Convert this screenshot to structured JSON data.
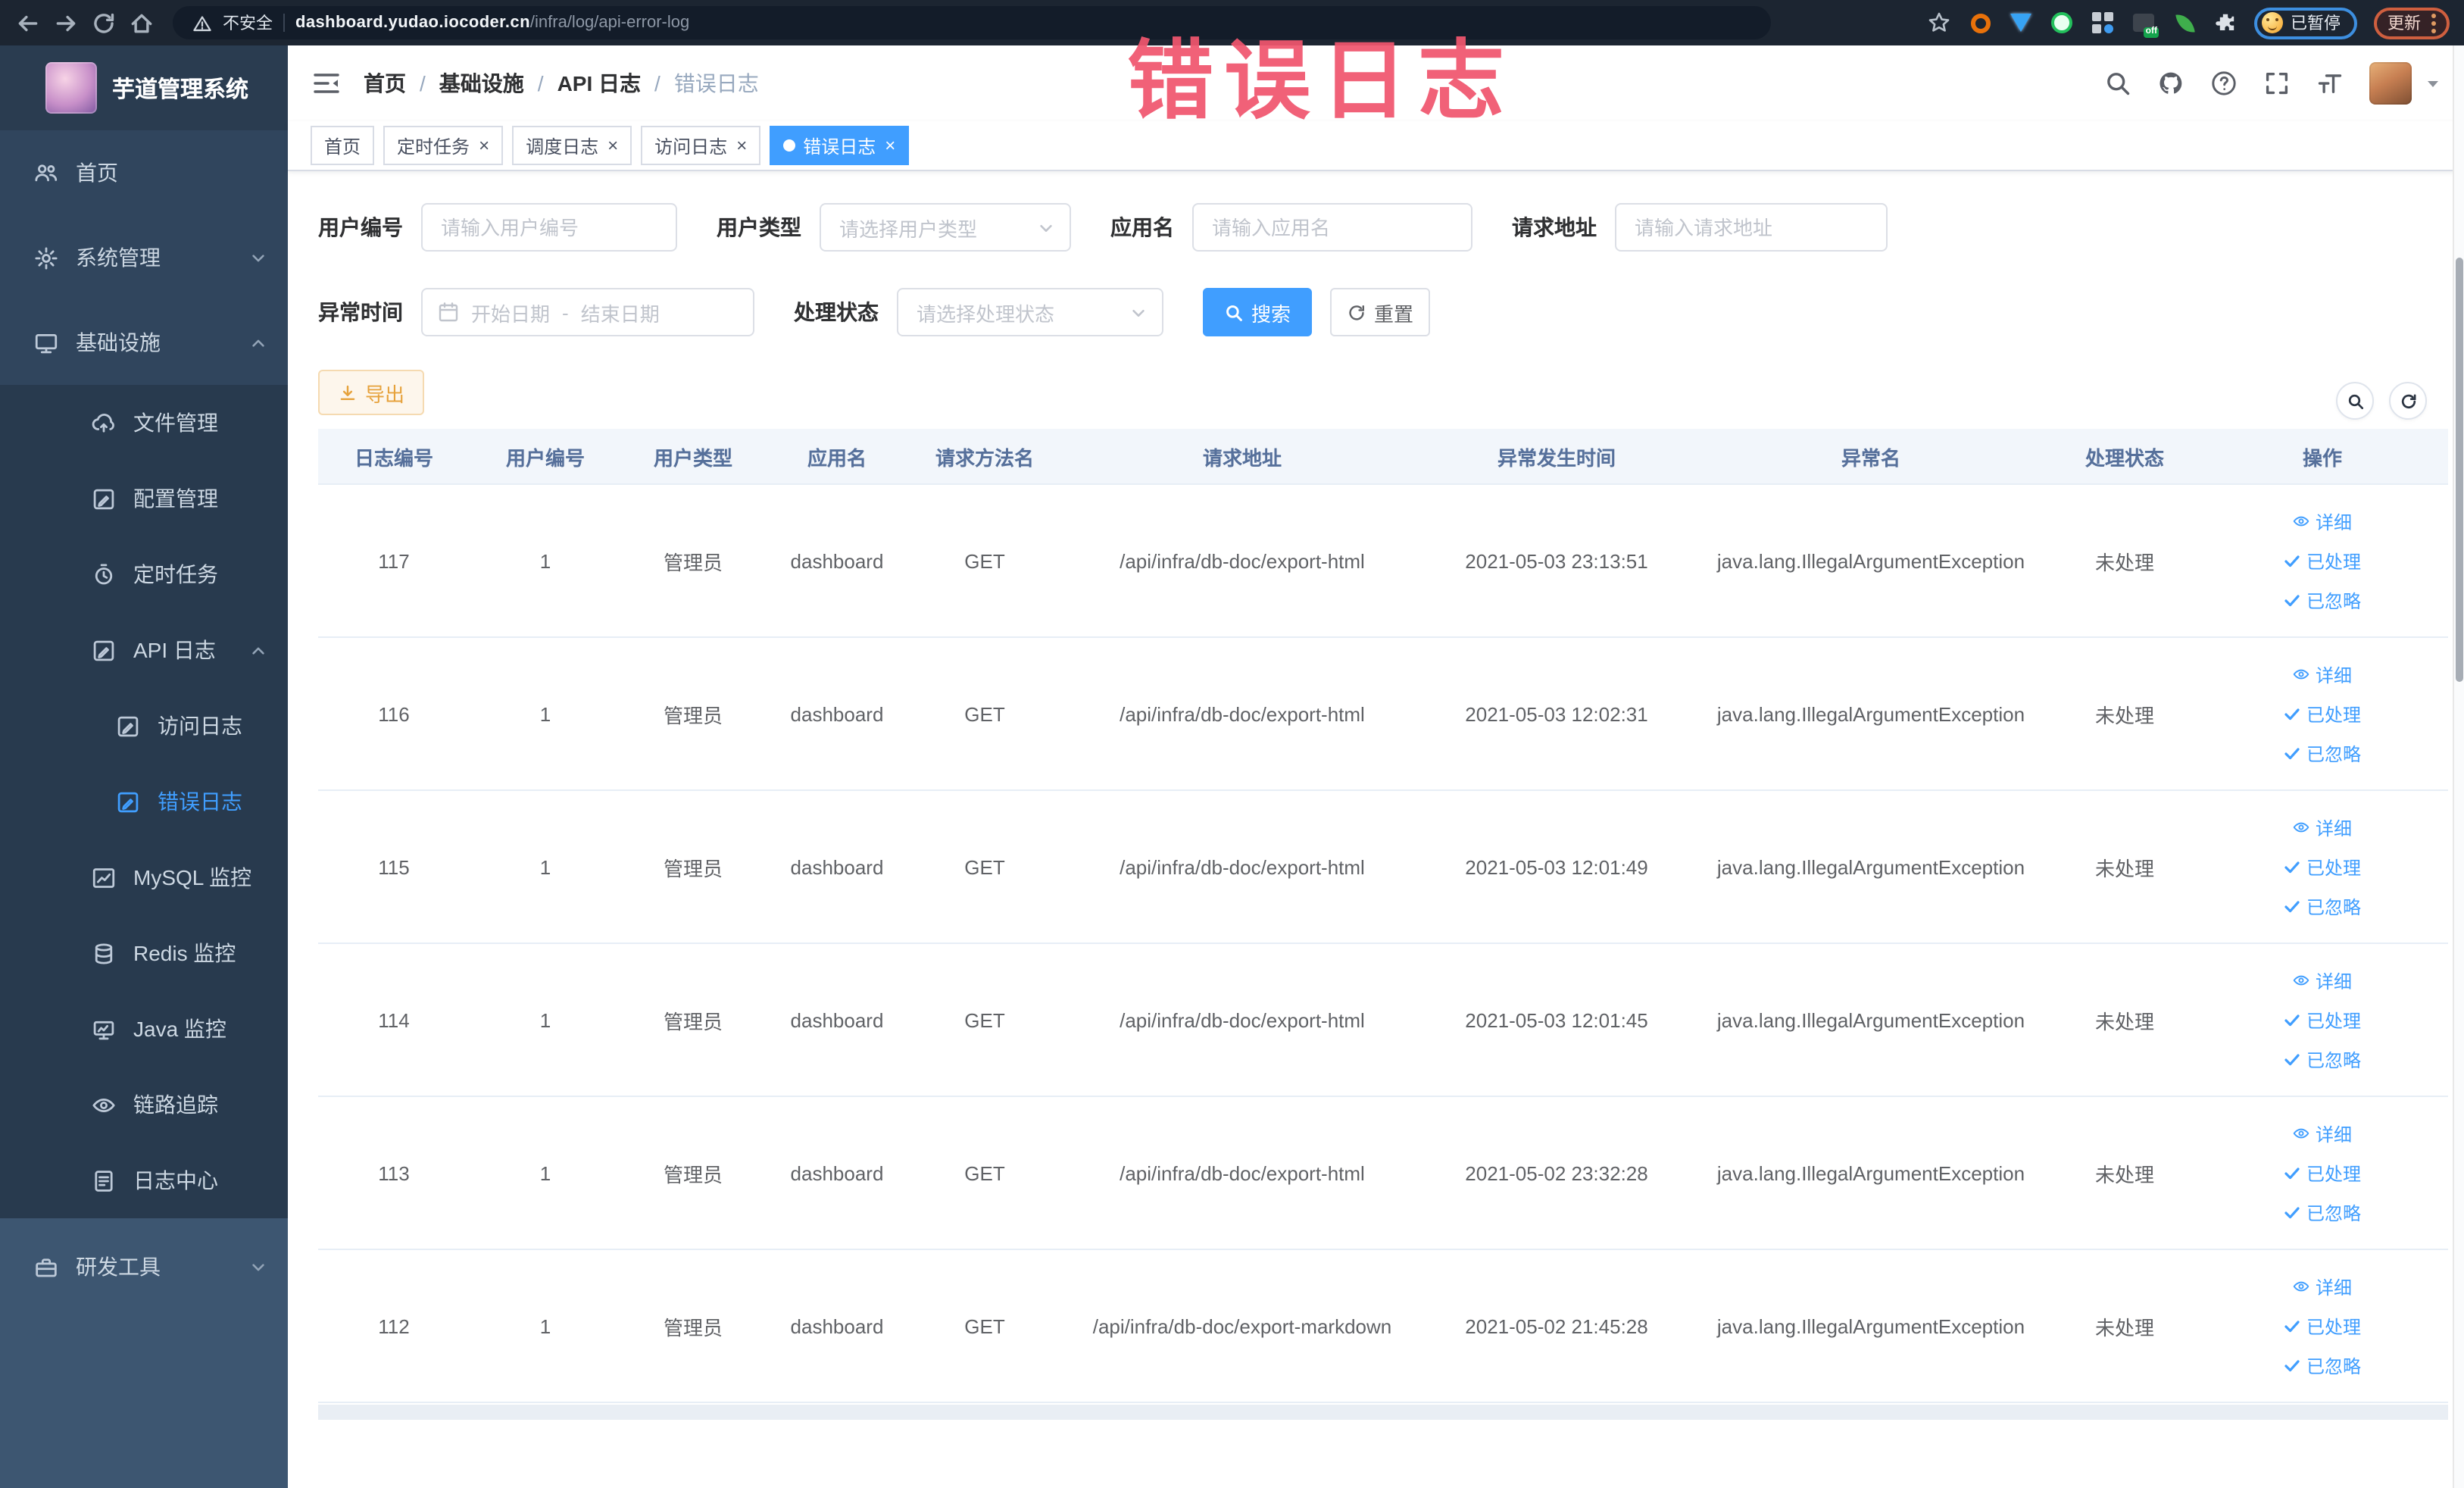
{
  "browser": {
    "security_label": "不安全",
    "url_domain": "dashboard.yudao.iocoder.cn",
    "url_path": "/infra/log/api-error-log",
    "paused_label": "已暂停",
    "update_label": "更新"
  },
  "watermark": {
    "text": "错误日志"
  },
  "sidebar": {
    "title": "芋道管理系统",
    "items": [
      {
        "label": "首页",
        "icon": "people-icon",
        "level": 0,
        "group": "top"
      },
      {
        "label": "系统管理",
        "icon": "gear-icon",
        "level": 0,
        "group": "top",
        "chevron": "down"
      },
      {
        "label": "基础设施",
        "icon": "monitor-icon",
        "level": 0,
        "group": "top",
        "chevron": "up"
      },
      {
        "label": "文件管理",
        "icon": "cloud-upload-icon",
        "level": 1,
        "group": "sub"
      },
      {
        "label": "配置管理",
        "icon": "edit-icon",
        "level": 1,
        "group": "sub"
      },
      {
        "label": "定时任务",
        "icon": "timer-icon",
        "level": 1,
        "group": "sub"
      },
      {
        "label": "API 日志",
        "icon": "log-edit-icon",
        "level": 1,
        "group": "sub",
        "chevron": "up"
      },
      {
        "label": "访问日志",
        "icon": "log-edit-icon",
        "level": 2,
        "group": "sub"
      },
      {
        "label": "错误日志",
        "icon": "log-edit-icon",
        "level": 2,
        "group": "sub",
        "active": true
      },
      {
        "label": "MySQL 监控",
        "icon": "chart-icon",
        "level": 1,
        "group": "sub"
      },
      {
        "label": "Redis 监控",
        "icon": "layers-icon",
        "level": 1,
        "group": "sub"
      },
      {
        "label": "Java 监控",
        "icon": "java-monitor-icon",
        "level": 1,
        "group": "sub"
      },
      {
        "label": "链路追踪",
        "icon": "eye-icon",
        "level": 1,
        "group": "sub"
      },
      {
        "label": "日志中心",
        "icon": "document-icon",
        "level": 1,
        "group": "sub"
      },
      {
        "label": "研发工具",
        "icon": "toolbox-icon",
        "level": 0,
        "group": "bottom",
        "chevron": "down"
      }
    ]
  },
  "breadcrumb": [
    "首页",
    "基础设施",
    "API 日志",
    "错误日志"
  ],
  "tabs": [
    {
      "label": "首页",
      "active": false,
      "closable": false
    },
    {
      "label": "定时任务",
      "active": false,
      "closable": true
    },
    {
      "label": "调度日志",
      "active": false,
      "closable": true
    },
    {
      "label": "访问日志",
      "active": false,
      "closable": true
    },
    {
      "label": "错误日志",
      "active": true,
      "closable": true
    }
  ],
  "filters": {
    "user_id": {
      "label": "用户编号",
      "placeholder": "请输入用户编号"
    },
    "user_type": {
      "label": "用户类型",
      "placeholder": "请选择用户类型"
    },
    "app_name": {
      "label": "应用名",
      "placeholder": "请输入应用名"
    },
    "request_url": {
      "label": "请求地址",
      "placeholder": "请输入请求地址"
    },
    "exception_time": {
      "label": "异常时间",
      "start_placeholder": "开始日期",
      "separator": "-",
      "end_placeholder": "结束日期"
    },
    "process_status": {
      "label": "处理状态",
      "placeholder": "请选择处理状态"
    },
    "search_label": "搜索",
    "reset_label": "重置"
  },
  "toolbar": {
    "export_label": "导出"
  },
  "table": {
    "columns": [
      "日志编号",
      "用户编号",
      "用户类型",
      "应用名",
      "请求方法名",
      "请求地址",
      "异常发生时间",
      "异常名",
      "处理状态",
      "操作"
    ],
    "actions": [
      {
        "label": "详细",
        "icon": "view-icon"
      },
      {
        "label": "已处理",
        "icon": "check-icon"
      },
      {
        "label": "已忽略",
        "icon": "check-icon"
      }
    ],
    "rows": [
      {
        "id": "117",
        "user_id": "1",
        "user_type": "管理员",
        "app": "dashboard",
        "method": "GET",
        "url": "/api/infra/db-doc/export-html",
        "time": "2021-05-03 23:13:51",
        "exception": "java.lang.IllegalArgumentException",
        "status": "未处理"
      },
      {
        "id": "116",
        "user_id": "1",
        "user_type": "管理员",
        "app": "dashboard",
        "method": "GET",
        "url": "/api/infra/db-doc/export-html",
        "time": "2021-05-03 12:02:31",
        "exception": "java.lang.IllegalArgumentException",
        "status": "未处理"
      },
      {
        "id": "115",
        "user_id": "1",
        "user_type": "管理员",
        "app": "dashboard",
        "method": "GET",
        "url": "/api/infra/db-doc/export-html",
        "time": "2021-05-03 12:01:49",
        "exception": "java.lang.IllegalArgumentException",
        "status": "未处理"
      },
      {
        "id": "114",
        "user_id": "1",
        "user_type": "管理员",
        "app": "dashboard",
        "method": "GET",
        "url": "/api/infra/db-doc/export-html",
        "time": "2021-05-03 12:01:45",
        "exception": "java.lang.IllegalArgumentException",
        "status": "未处理"
      },
      {
        "id": "113",
        "user_id": "1",
        "user_type": "管理员",
        "app": "dashboard",
        "method": "GET",
        "url": "/api/infra/db-doc/export-html",
        "time": "2021-05-02 23:32:28",
        "exception": "java.lang.IllegalArgumentException",
        "status": "未处理"
      },
      {
        "id": "112",
        "user_id": "1",
        "user_type": "管理员",
        "app": "dashboard",
        "method": "GET",
        "url": "/api/infra/db-doc/export-markdown",
        "time": "2021-05-02 21:45:28",
        "exception": "java.lang.IllegalArgumentException",
        "status": "未处理"
      }
    ]
  },
  "colors": {
    "accent": "#409eff",
    "warning": "#e6a23c",
    "watermark_pink": "#f0566e",
    "sidebar_bg": "#30455d",
    "sidebar_submenu_bg": "#283a4e",
    "chrome_bg": "#1c2531"
  }
}
